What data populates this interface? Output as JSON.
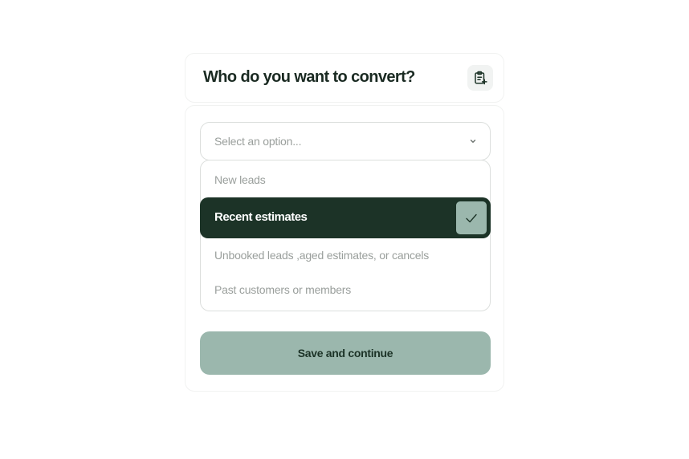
{
  "header": {
    "title": "Who do you want to convert?",
    "icon": "clipboard-add-icon"
  },
  "select": {
    "placeholder": "Select an option...",
    "chevron_icon": "chevron-down-icon"
  },
  "options": [
    {
      "label": "New leads",
      "selected": false
    },
    {
      "label": "Recent estimates",
      "selected": true
    },
    {
      "label": "Unbooked leads ,aged estimates, or cancels",
      "selected": false
    },
    {
      "label": "Past customers or members",
      "selected": false
    }
  ],
  "selected_check_icon": "check-icon",
  "save_button": {
    "label": "Save and continue"
  },
  "colors": {
    "primary_dark": "#1c3327",
    "accent_sage": "#9bb7ad",
    "muted_text": "#9a9f9c",
    "border": "#dcdfdd"
  }
}
